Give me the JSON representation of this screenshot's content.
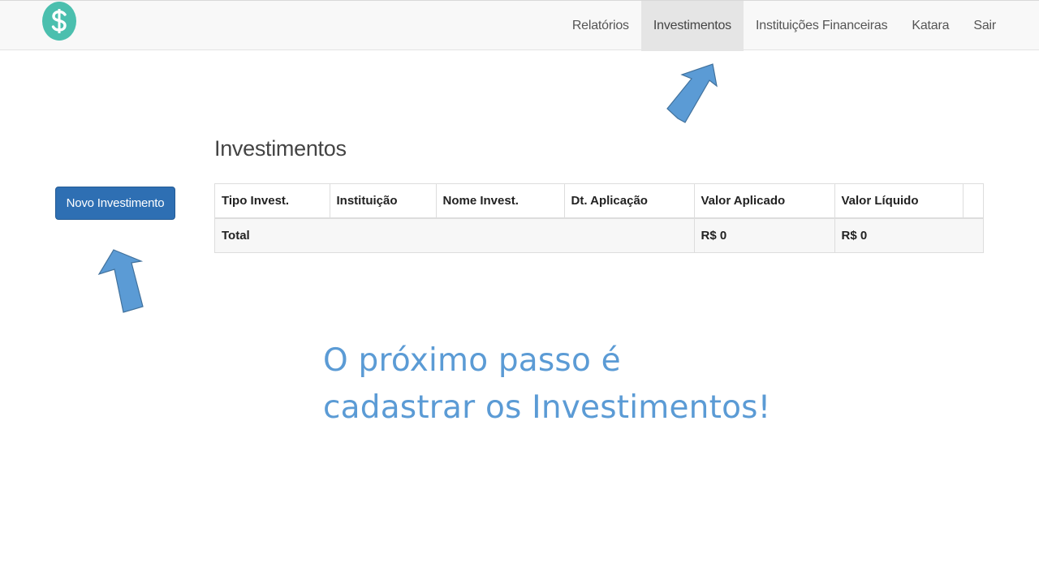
{
  "brand": {
    "logo_icon": "dollar-icon",
    "logo_color": "#4bbfae"
  },
  "nav": {
    "items": [
      {
        "label": "Relatórios"
      },
      {
        "label": "Investimentos"
      },
      {
        "label": "Instituições Financeiras"
      },
      {
        "label": "Katara"
      },
      {
        "label": "Sair"
      }
    ],
    "active": "Investimentos"
  },
  "page": {
    "title": "Investimentos"
  },
  "actions": {
    "new_label": "Novo Investimento",
    "new_color": "#2e6fb3"
  },
  "table": {
    "headers": [
      "Tipo Invest.",
      "Instituição",
      "Nome Invest.",
      "Dt. Aplicação",
      "Valor Aplicado",
      "Valor Líquido",
      ""
    ],
    "total": {
      "label": "Total",
      "valor_aplicado": "R$ 0",
      "valor_liquido": "R$ 0"
    }
  },
  "annotation": {
    "line1": "O próximo passo é",
    "line2": "cadastrar os Investimentos!",
    "color": "#5b9bd5",
    "arrow_icons": [
      "arrow-up-icon",
      "arrow-up-icon"
    ],
    "arrow_color": "#5b9bd5"
  }
}
